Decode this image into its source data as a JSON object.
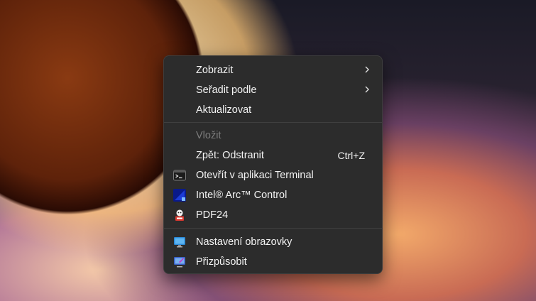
{
  "context_menu": {
    "items": [
      {
        "label": "Zobrazit",
        "submenu": true
      },
      {
        "label": "Seřadit podle",
        "submenu": true
      },
      {
        "label": "Aktualizovat"
      },
      {
        "label": "Vložit",
        "disabled": true
      },
      {
        "label": "Zpět: Odstranit",
        "shortcut": "Ctrl+Z"
      },
      {
        "label": "Otevřít v aplikaci Terminal",
        "icon": "terminal-icon"
      },
      {
        "label": "Intel® Arc™ Control",
        "icon": "intel-arc-icon"
      },
      {
        "label": "PDF24",
        "icon": "pdf24-icon"
      },
      {
        "label": "Nastavení obrazovky",
        "icon": "display-settings-icon"
      },
      {
        "label": "Přizpůsobit",
        "icon": "personalize-icon"
      }
    ]
  },
  "colors": {
    "menu_bg": "#2c2c2c",
    "text": "#f3f3f3",
    "disabled_text": "#7c7c7c",
    "separator": "#3f3f3f"
  }
}
